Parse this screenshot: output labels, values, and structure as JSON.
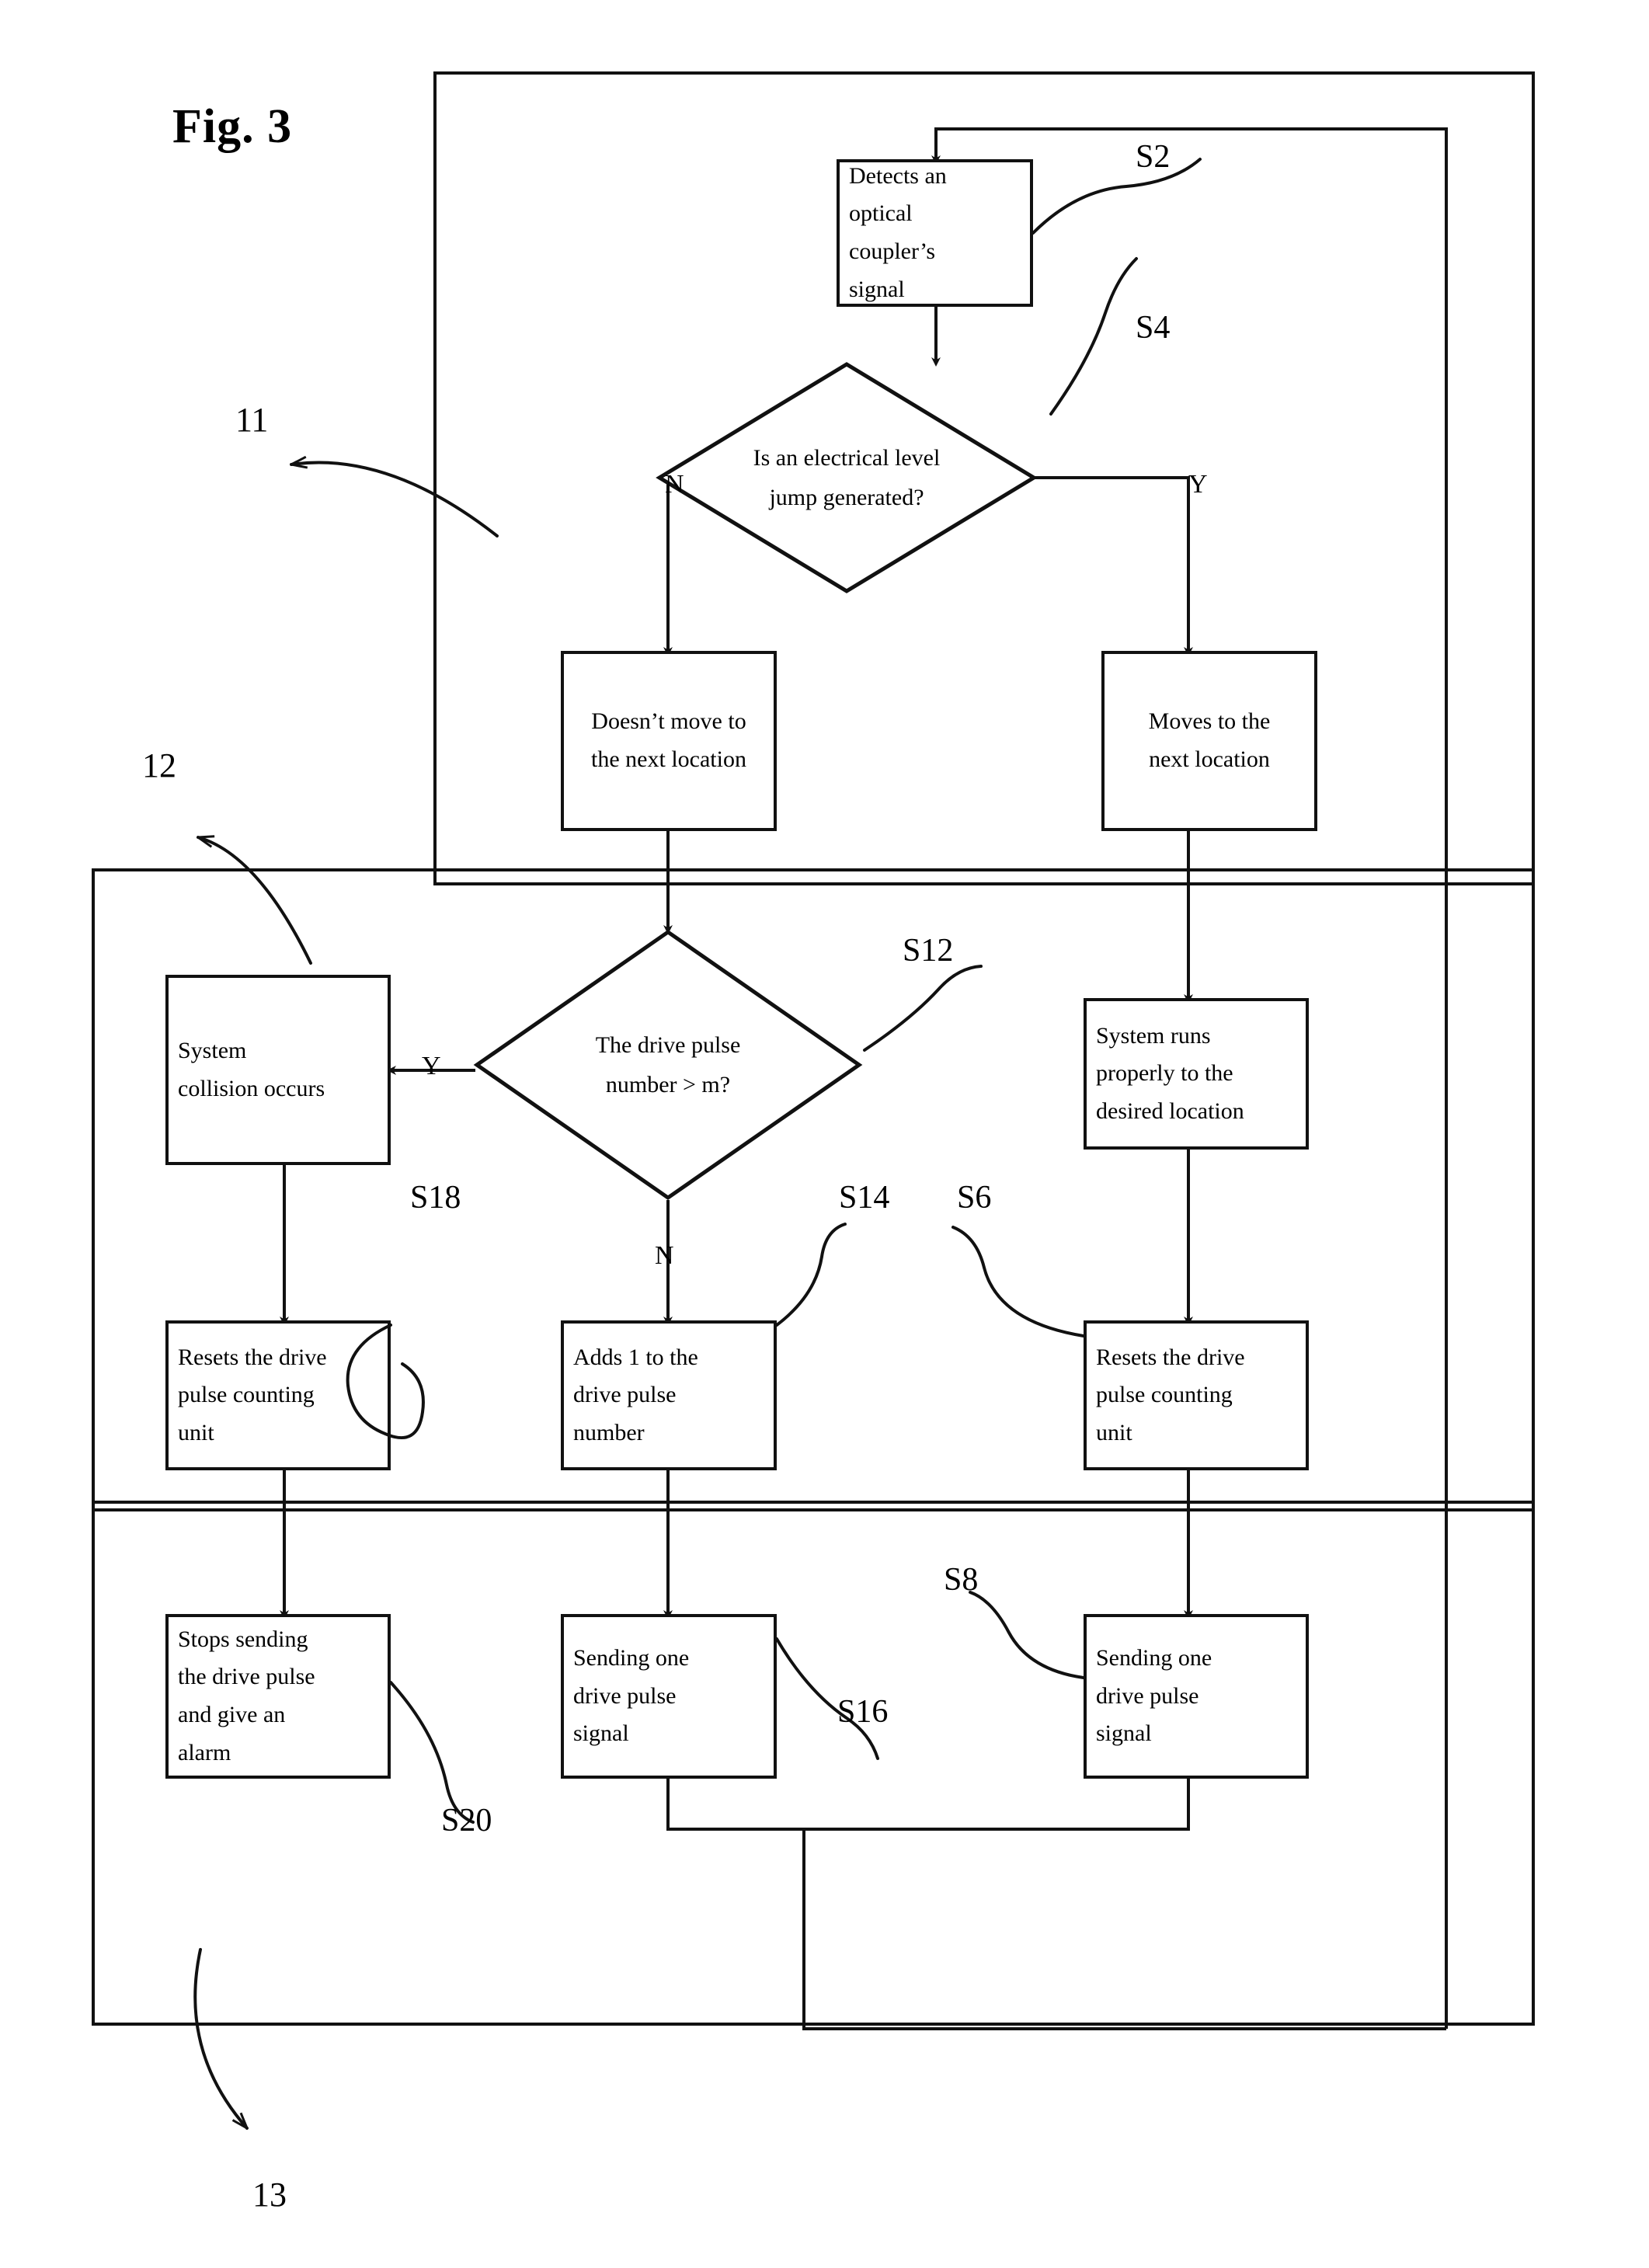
{
  "figure": {
    "title": "Fig. 3"
  },
  "reference_numerals": [
    {
      "id": "ref-11",
      "label": "11"
    },
    {
      "id": "ref-12",
      "label": "12"
    },
    {
      "id": "ref-13",
      "label": "13"
    }
  ],
  "nodes": [
    {
      "id": "s2-detect",
      "step": "S2",
      "shape": "process",
      "align": "left",
      "lines": [
        "Detects an",
        "optical",
        "coupler’s",
        "signal"
      ]
    },
    {
      "id": "s4-decision",
      "step": "S4",
      "shape": "decision",
      "align": "center",
      "lines": [
        "Is an electrical level",
        "jump generated?"
      ]
    },
    {
      "id": "no-move",
      "step": "",
      "shape": "process",
      "align": "center",
      "lines": [
        "Doesn’t move to",
        "the next location"
      ]
    },
    {
      "id": "moves-next",
      "step": "",
      "shape": "process",
      "align": "center",
      "lines": [
        "Moves to the",
        "next location"
      ]
    },
    {
      "id": "s12-decision",
      "step": "S12",
      "shape": "decision",
      "align": "center",
      "lines": [
        "The drive pulse",
        "number > m?"
      ]
    },
    {
      "id": "collision",
      "step": "",
      "shape": "process",
      "align": "left",
      "lines": [
        "System",
        "collision occurs"
      ]
    },
    {
      "id": "runs-properly",
      "step": "",
      "shape": "process",
      "align": "left",
      "lines": [
        "System runs",
        "properly to the",
        "desired location"
      ]
    },
    {
      "id": "s18-reset",
      "step": "S18",
      "shape": "process",
      "align": "left",
      "lines": [
        "Resets the drive",
        "pulse counting",
        "unit"
      ]
    },
    {
      "id": "s14-add",
      "step": "S14",
      "shape": "process",
      "align": "left",
      "lines": [
        "Adds 1 to the",
        "drive pulse",
        "number"
      ]
    },
    {
      "id": "s6-reset",
      "step": "S6",
      "shape": "process",
      "align": "left",
      "lines": [
        "Resets the drive",
        "pulse counting",
        "unit"
      ]
    },
    {
      "id": "s20-stop",
      "step": "S20",
      "shape": "process",
      "align": "left",
      "lines": [
        "Stops sending",
        "the drive pulse",
        "and give an",
        "alarm"
      ]
    },
    {
      "id": "s16-send",
      "step": "S16",
      "shape": "process",
      "align": "left",
      "lines": [
        "Sending one",
        "drive pulse",
        "signal"
      ]
    },
    {
      "id": "s8-send",
      "step": "S8",
      "shape": "process",
      "align": "left",
      "lines": [
        "Sending one",
        "drive pulse",
        "signal"
      ]
    }
  ],
  "step_labels": {
    "s2": "S2",
    "s4": "S4",
    "s6": "S6",
    "s8": "S8",
    "s12": "S12",
    "s14": "S14",
    "s16": "S16",
    "s18": "S18",
    "s20": "S20"
  },
  "branch_labels": {
    "s4_no": "N",
    "s4_yes": "Y",
    "s12_yes": "Y",
    "s12_no": "N"
  },
  "colors": {
    "ink": "#111111",
    "paper": "#ffffff"
  }
}
